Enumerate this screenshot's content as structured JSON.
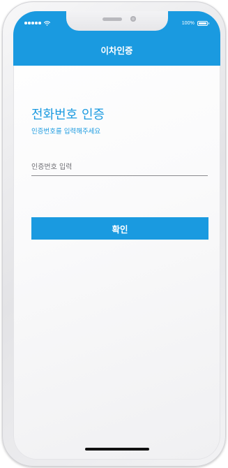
{
  "status_bar": {
    "battery_text": "100%",
    "signal_icon": "signal-dots-icon",
    "wifi_icon": "wifi-icon",
    "battery_icon": "battery-icon"
  },
  "app_bar": {
    "title": "이차인증"
  },
  "main": {
    "heading": "전화번호 인증",
    "subheading": "인증번호를 입력해주세요",
    "code_input": {
      "placeholder": "인증번호 입력",
      "value": ""
    },
    "confirm_label": "확인"
  },
  "colors": {
    "accent": "#1a9ae0",
    "on_accent": "#ffffff"
  }
}
